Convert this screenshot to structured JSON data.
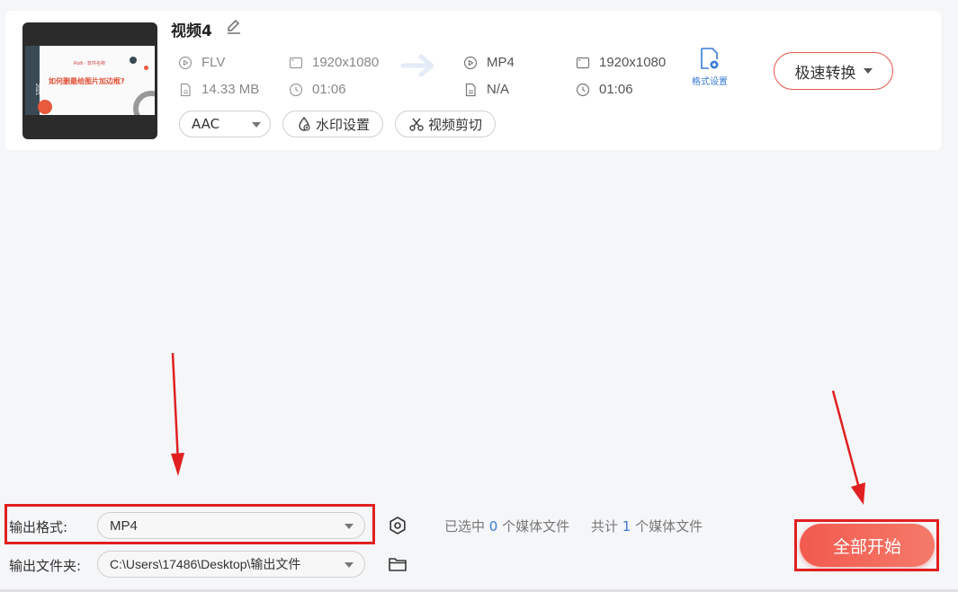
{
  "file": {
    "title": "视频4",
    "thumbnail": {
      "year": "2021",
      "brand": "Ruth · 软件名称",
      "headline": "如何删最给图片加边框?"
    },
    "source": {
      "format": "FLV",
      "resolution": "1920x1080",
      "size": "14.33 MB",
      "duration": "01:06"
    },
    "target": {
      "format": "MP4",
      "resolution": "1920x1080",
      "size": "N/A",
      "duration": "01:06"
    },
    "audio_select": "AAC",
    "watermark_label": "水印设置",
    "trim_label": "视频剪切",
    "format_settings_label": "格式设置",
    "speed_convert_label": "极速转换"
  },
  "bottom": {
    "output_format_label": "输出格式:",
    "output_format_value": "MP4",
    "output_folder_label": "输出文件夹:",
    "output_folder_value": "C:\\Users\\17486\\Desktop\\输出文件",
    "status_selected_prefix": "已选中",
    "status_selected_count": "0",
    "status_selected_suffix": "个媒体文件",
    "status_total_prefix": "共计",
    "status_total_count": "1",
    "status_total_suffix": "个媒体文件",
    "start_all_label": "全部开始"
  },
  "colors": {
    "accent_red": "#e02020",
    "button_red": "#f25a4e",
    "link_blue": "#3a7bd5"
  }
}
